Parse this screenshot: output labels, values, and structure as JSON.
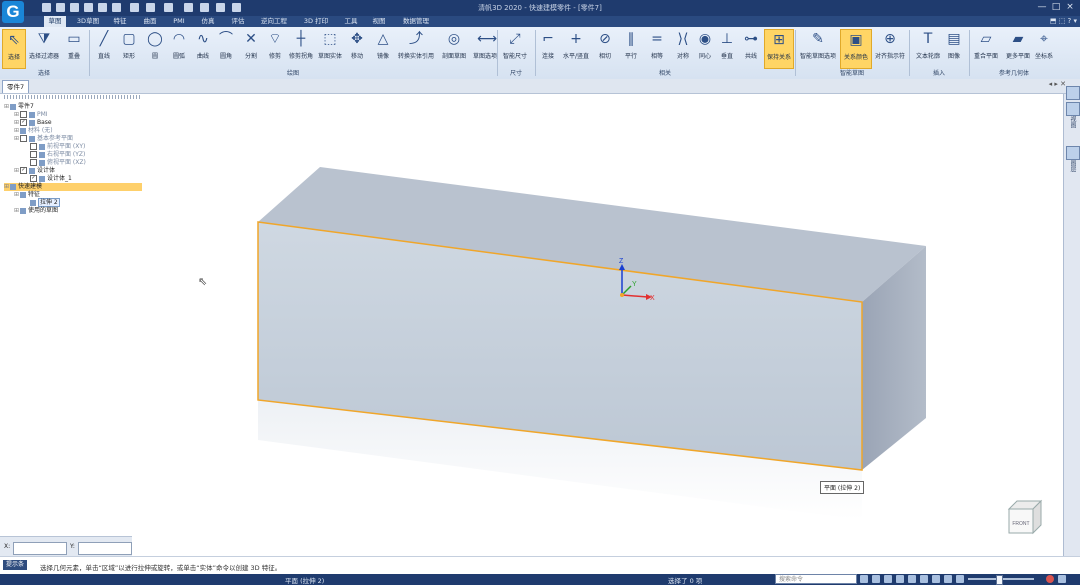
{
  "app": {
    "logo": "G",
    "window_title": "清帆3D 2020 - 快速建模零件 - [零件7]",
    "window_controls": [
      "—",
      "□",
      "×"
    ]
  },
  "tabs": [
    "草图",
    "3D草图",
    "特征",
    "曲面",
    "PMI",
    "仿真",
    "评估",
    "逆向工程",
    "3D 打印",
    "工具",
    "视图",
    "数据管理"
  ],
  "active_tab": "草图",
  "ribbon": {
    "tools": [
      {
        "id": "select",
        "label": "选择",
        "icon": "arrow-pointer-icon",
        "active": true
      },
      {
        "id": "select-filter",
        "label": "选择过滤器",
        "icon": "funnel-icon"
      },
      {
        "id": "rename",
        "label": "重叠",
        "icon": "layers-icon"
      },
      {
        "id": "line",
        "label": "直线",
        "icon": "line-icon"
      },
      {
        "id": "rect",
        "label": "矩形",
        "icon": "rectangle-icon"
      },
      {
        "id": "circle",
        "label": "圆",
        "icon": "circle-icon"
      },
      {
        "id": "arc",
        "label": "圆弧",
        "icon": "arc-icon"
      },
      {
        "id": "curve",
        "label": "曲线",
        "icon": "spline-icon"
      },
      {
        "id": "fillet",
        "label": "圆角",
        "icon": "fillet-icon"
      },
      {
        "id": "split",
        "label": "分割",
        "icon": "split-icon"
      },
      {
        "id": "trim",
        "label": "修剪",
        "icon": "trim-icon"
      },
      {
        "id": "offset-fillet",
        "label": "修剪拐角",
        "icon": "corner-icon"
      },
      {
        "id": "sketch-entity",
        "label": "草图实体",
        "icon": "entity-icon"
      },
      {
        "id": "move",
        "label": "移动",
        "icon": "move-icon"
      },
      {
        "id": "mirror",
        "label": "镜像",
        "icon": "mirror-icon"
      },
      {
        "id": "convert-ref",
        "label": "转换实体引用",
        "icon": "convert-icon"
      },
      {
        "id": "section-sketch",
        "label": "剖面草图",
        "icon": "section-icon"
      },
      {
        "id": "sketch-options",
        "label": "草图选项",
        "icon": "sketch-options-icon"
      },
      {
        "id": "smart-dim",
        "label": "智能尺寸",
        "icon": "dimension-icon"
      },
      {
        "id": "coincident",
        "label": "连接",
        "icon": "coincident-icon"
      },
      {
        "id": "horiz-vert",
        "label": "水平/竖直",
        "icon": "plus-icon"
      },
      {
        "id": "tangent",
        "label": "相切",
        "icon": "tangent-icon"
      },
      {
        "id": "parallel",
        "label": "平行",
        "icon": "parallel-icon"
      },
      {
        "id": "equal",
        "label": "相等",
        "icon": "equal-icon"
      },
      {
        "id": "symmetric",
        "label": "对称",
        "icon": "symmetric-icon"
      },
      {
        "id": "concentric",
        "label": "同心",
        "icon": "concentric-icon"
      },
      {
        "id": "perpendicular",
        "label": "垂直",
        "icon": "perpendicular-icon"
      },
      {
        "id": "collinear",
        "label": "共线",
        "icon": "collinear-icon"
      },
      {
        "id": "keep-relations",
        "label": "保持关系",
        "icon": "relations-icon",
        "active": true
      },
      {
        "id": "smart-sketch-options",
        "label": "智能草图选项",
        "icon": "bulb-icon"
      },
      {
        "id": "relation-color",
        "label": "关系颜色",
        "icon": "color-box-icon",
        "active": true
      },
      {
        "id": "alignment",
        "label": "对齐指示符",
        "icon": "crosshair-icon"
      },
      {
        "id": "text-outline",
        "label": "文本轮廓",
        "icon": "text-icon"
      },
      {
        "id": "image",
        "label": "图像",
        "icon": "image-icon"
      },
      {
        "id": "coincident-plane",
        "label": "重合平面",
        "icon": "plane-icon"
      },
      {
        "id": "more-planes",
        "label": "更多平面",
        "icon": "planes-icon"
      },
      {
        "id": "coord-system",
        "label": "坐标系",
        "icon": "axis-icon"
      }
    ],
    "groups": [
      "选择",
      "绘图",
      "尺寸",
      "相关",
      "智能草图",
      "插入",
      "参考几何体"
    ]
  },
  "document_tab": "零件7",
  "doc_nav": "◂ ▸ ✕",
  "tree": [
    {
      "label": "零件7",
      "level": 0,
      "icon": "part-icon"
    },
    {
      "label": "PMI",
      "level": 1,
      "dim": true,
      "checkbox": false
    },
    {
      "label": "Base",
      "level": 1,
      "checkbox": true
    },
    {
      "label": "材料 (无)",
      "level": 1,
      "dim": true
    },
    {
      "label": "基本参考平面",
      "level": 1,
      "dim": true,
      "checkbox": false
    },
    {
      "label": "前视平面 (XY)",
      "level": 2,
      "dim": true,
      "checkbox": false
    },
    {
      "label": "右视平面 (YZ)",
      "level": 2,
      "dim": true,
      "checkbox": false
    },
    {
      "label": "俯视平面 (XZ)",
      "level": 2,
      "dim": true,
      "checkbox": false
    },
    {
      "label": "设计体",
      "level": 1,
      "checkbox": true
    },
    {
      "label": "设计体_1",
      "level": 2,
      "checkbox": true
    },
    {
      "label": "快速建模",
      "level": 0,
      "highlight": true
    },
    {
      "label": "特征",
      "level": 1
    },
    {
      "label": "拉伸 2",
      "level": 2,
      "selected": true
    },
    {
      "label": "使用的草图",
      "level": 1
    }
  ],
  "coord_fields": [
    {
      "label": "X:"
    },
    {
      "label": "Y:"
    }
  ],
  "viewport": {
    "model_label": "平面 (拉伸 2)",
    "axes": {
      "z": "Z",
      "y": "Y",
      "x": "X"
    },
    "view_cube": "FRONT",
    "colors": {
      "front": "#c5d0dc",
      "top": "#b9c2cf",
      "side": "#a0aab9",
      "edge": "#f0a62a"
    }
  },
  "right_strip": {
    "labels": [
      "视图",
      "图层"
    ]
  },
  "prompt": {
    "label": "提示条",
    "text": "选择几何元素，单击“区域”以进行拉伸或旋转，或单击“实体”命令以创建 3D 特征。"
  },
  "status": {
    "left": "平面 (拉伸 2)",
    "middle": "选择了 0 项",
    "search_placeholder": "搜索命令"
  }
}
